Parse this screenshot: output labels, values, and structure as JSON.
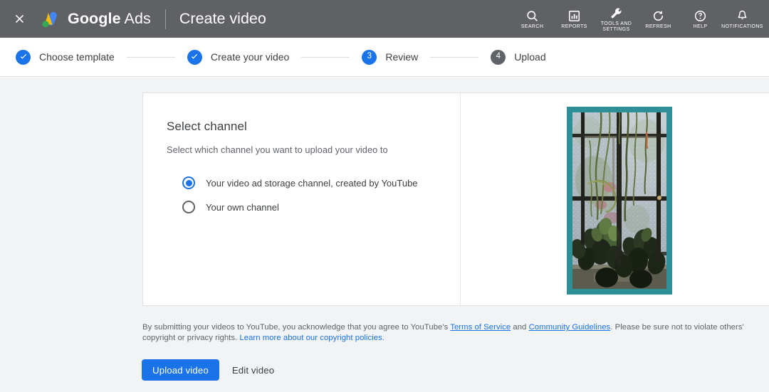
{
  "appbar": {
    "close_icon": "close-icon",
    "logo_icon": "google-ads-logo",
    "brand_google": "Google",
    "brand_ads": "Ads",
    "page_title": "Create video",
    "tools": [
      {
        "icon": "search-icon",
        "label": "SEARCH"
      },
      {
        "icon": "reports-icon",
        "label": "REPORTS"
      },
      {
        "icon": "wrench-icon",
        "label": "TOOLS AND\nSETTINGS"
      },
      {
        "icon": "refresh-icon",
        "label": "REFRESH"
      },
      {
        "icon": "help-icon",
        "label": "HELP"
      },
      {
        "icon": "bell-icon",
        "label": "NOTIFICATIONS"
      }
    ]
  },
  "stepper": {
    "steps": [
      {
        "label": "Choose template",
        "state": "done",
        "num": "1"
      },
      {
        "label": "Create your video",
        "state": "done",
        "num": "2"
      },
      {
        "label": "Review",
        "state": "active",
        "num": "3"
      },
      {
        "label": "Upload",
        "state": "todo",
        "num": "4"
      }
    ]
  },
  "card": {
    "title": "Select channel",
    "subtitle": "Select which channel you want to upload your video to",
    "options": [
      {
        "label": "Your video ad storage channel, created by YouTube",
        "selected": true
      },
      {
        "label": "Your own channel",
        "selected": false
      }
    ],
    "preview": {
      "name": "video-preview-thumbnail",
      "alt": "Cactus plants on a windowsill in front of a frosted window"
    }
  },
  "legal": {
    "part1": "By submitting your videos to YouTube, you acknowledge that you agree to YouTube's ",
    "link_terms": "Terms of Service",
    "part2": " and ",
    "link_guidelines": "Community Guidelines",
    "part3": ". Please be sure not to violate others' copyright or privacy rights. ",
    "link_copyright": "Learn more about our copyright policies."
  },
  "actions": {
    "primary_label": "Upload video",
    "secondary_label": "Edit video"
  },
  "colors": {
    "appbar_bg": "#5f6165",
    "accent": "#1a73e8",
    "page_bg": "#f1f3f4",
    "step_todo": "#5f6368",
    "preview_border": "#2f8f96"
  }
}
